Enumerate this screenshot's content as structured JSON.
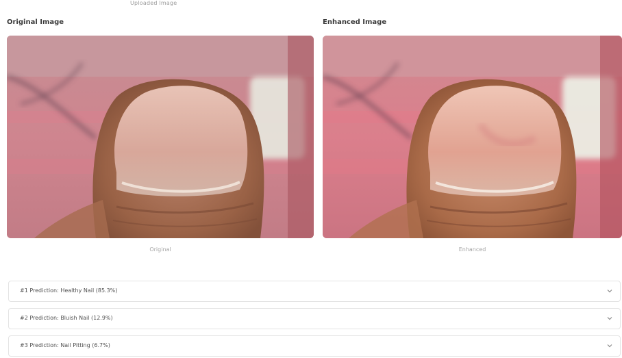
{
  "top_caption": "Uploaded Image",
  "original": {
    "title": "Original Image",
    "caption": "Original"
  },
  "enhanced": {
    "title": "Enhanced Image",
    "caption": "Enhanced"
  },
  "predictions": [
    {
      "label": "#1 Prediction: Healthy Nail (85.3%)",
      "icon": "chevron-down-icon"
    },
    {
      "label": "#2 Prediction: Bluish Nail (12.9%)",
      "icon": "chevron-down-icon"
    },
    {
      "label": "#3 Prediction: Nail Pitting (6.7%)",
      "icon": "chevron-down-icon"
    }
  ]
}
